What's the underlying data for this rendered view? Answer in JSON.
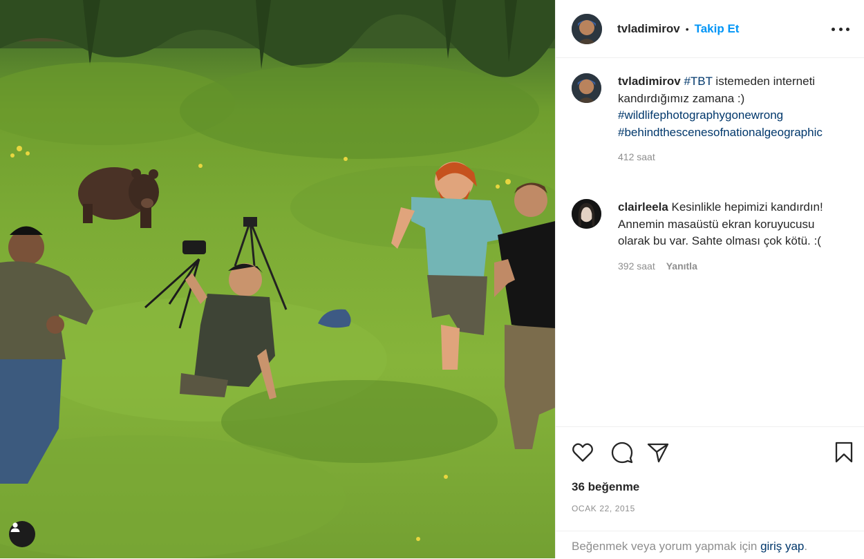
{
  "post": {
    "author": "tvladimirov",
    "separator": "•",
    "follow_label": "Takip Et",
    "more_options_icon": "more-horizontal-icon",
    "media": {
      "user_tag_icon": "user-tag-icon",
      "colors": {
        "grass": "#7cab35",
        "trees": "#3a5a26",
        "bear": "#4a3226"
      }
    }
  },
  "caption": {
    "username": "tvladimirov",
    "tag_tbt": "#TBT",
    "text": " istemeden interneti kandırdığımız zamana :)",
    "tag_1": "#wildlifephotographygonewrong",
    "tag_2": "#behindthescenesofnationalgeographic",
    "time": "412 saat"
  },
  "comment": {
    "username": "clairleela",
    "text": " Kesinlikle hepimizi kandırdın! Annemin masaüstü ekran koruyucusu olarak bu var. Sahte olması çok kötü. :(",
    "time": "392 saat",
    "reply_label": "Yanıtla"
  },
  "actions": {
    "like_icon": "heart-icon",
    "comment_icon": "comment-icon",
    "share_icon": "share-icon",
    "save_icon": "bookmark-icon",
    "likes": "36 beğenme",
    "date": "OCAK 22, 2015"
  },
  "login": {
    "prefix": "Beğenmek veya yorum yapmak için ",
    "link": "giriş yap",
    "suffix": "."
  },
  "colors": {
    "text": "#262626",
    "secondary": "#8e8e8e",
    "link": "#00376b",
    "accent": "#0095f6",
    "divider": "#efefef"
  }
}
